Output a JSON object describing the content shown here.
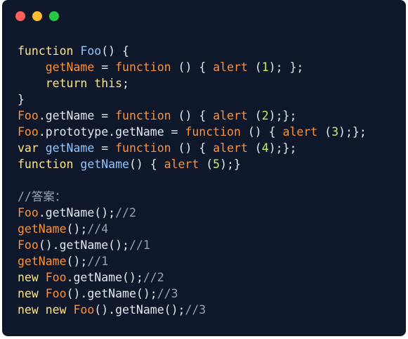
{
  "window": {
    "controls": [
      {
        "name": "close",
        "color": "#ff5f57"
      },
      {
        "name": "minimize",
        "color": "#febc2e"
      },
      {
        "name": "maximize",
        "color": "#28c840"
      }
    ],
    "background": "#0f172a"
  },
  "code": {
    "lines": [
      [
        {
          "t": "function ",
          "c": "kw"
        },
        {
          "t": "Foo",
          "c": "name"
        },
        {
          "t": "() {",
          "c": "punc"
        }
      ],
      [
        {
          "t": "    ",
          "c": "plain"
        },
        {
          "t": "getName",
          "c": "ident"
        },
        {
          "t": " = ",
          "c": "punc"
        },
        {
          "t": "function",
          "c": "ident"
        },
        {
          "t": " () { ",
          "c": "punc"
        },
        {
          "t": "alert",
          "c": "ident"
        },
        {
          "t": " (",
          "c": "punc"
        },
        {
          "t": "1",
          "c": "num"
        },
        {
          "t": "); };",
          "c": "punc"
        }
      ],
      [
        {
          "t": "    ",
          "c": "plain"
        },
        {
          "t": "return this",
          "c": "kw"
        },
        {
          "t": ";",
          "c": "punc"
        }
      ],
      [
        {
          "t": "}",
          "c": "punc"
        }
      ],
      [
        {
          "t": "Foo",
          "c": "ident"
        },
        {
          "t": ".getName = ",
          "c": "punc"
        },
        {
          "t": "function",
          "c": "ident"
        },
        {
          "t": " () { ",
          "c": "punc"
        },
        {
          "t": "alert",
          "c": "ident"
        },
        {
          "t": " (",
          "c": "punc"
        },
        {
          "t": "2",
          "c": "num"
        },
        {
          "t": ");};",
          "c": "punc"
        }
      ],
      [
        {
          "t": "Foo",
          "c": "ident"
        },
        {
          "t": ".prototype.getName = ",
          "c": "punc"
        },
        {
          "t": "function",
          "c": "ident"
        },
        {
          "t": " () { ",
          "c": "punc"
        },
        {
          "t": "alert",
          "c": "ident"
        },
        {
          "t": " (",
          "c": "punc"
        },
        {
          "t": "3",
          "c": "num"
        },
        {
          "t": ");};",
          "c": "punc"
        }
      ],
      [
        {
          "t": "var ",
          "c": "kw"
        },
        {
          "t": "getName",
          "c": "name"
        },
        {
          "t": " = ",
          "c": "punc"
        },
        {
          "t": "function",
          "c": "ident"
        },
        {
          "t": " () { ",
          "c": "punc"
        },
        {
          "t": "alert",
          "c": "ident"
        },
        {
          "t": " (",
          "c": "punc"
        },
        {
          "t": "4",
          "c": "num"
        },
        {
          "t": ");};",
          "c": "punc"
        }
      ],
      [
        {
          "t": "function ",
          "c": "kw"
        },
        {
          "t": "getName",
          "c": "name"
        },
        {
          "t": "() { ",
          "c": "punc"
        },
        {
          "t": "alert",
          "c": "ident"
        },
        {
          "t": " (",
          "c": "punc"
        },
        {
          "t": "5",
          "c": "num"
        },
        {
          "t": ");}",
          "c": "punc"
        }
      ],
      [],
      [
        {
          "t": "//答案：",
          "c": "cm"
        }
      ],
      [
        {
          "t": "Foo",
          "c": "ident"
        },
        {
          "t": ".getName();",
          "c": "punc"
        },
        {
          "t": "//2",
          "c": "cm"
        }
      ],
      [
        {
          "t": "getName",
          "c": "ident"
        },
        {
          "t": "();",
          "c": "punc"
        },
        {
          "t": "//4",
          "c": "cm"
        }
      ],
      [
        {
          "t": "Foo",
          "c": "ident"
        },
        {
          "t": "().getName();",
          "c": "punc"
        },
        {
          "t": "//1",
          "c": "cm"
        }
      ],
      [
        {
          "t": "getName",
          "c": "ident"
        },
        {
          "t": "();",
          "c": "punc"
        },
        {
          "t": "//1",
          "c": "cm"
        }
      ],
      [
        {
          "t": "new ",
          "c": "kw"
        },
        {
          "t": "Foo",
          "c": "ident"
        },
        {
          "t": ".getName();",
          "c": "punc"
        },
        {
          "t": "//2",
          "c": "cm"
        }
      ],
      [
        {
          "t": "new ",
          "c": "kw"
        },
        {
          "t": "Foo",
          "c": "ident"
        },
        {
          "t": "().getName();",
          "c": "punc"
        },
        {
          "t": "//3",
          "c": "cm"
        }
      ],
      [
        {
          "t": "new new ",
          "c": "kw"
        },
        {
          "t": "Foo",
          "c": "ident"
        },
        {
          "t": "().getName();",
          "c": "punc"
        },
        {
          "t": "//3",
          "c": "cm"
        }
      ]
    ]
  }
}
